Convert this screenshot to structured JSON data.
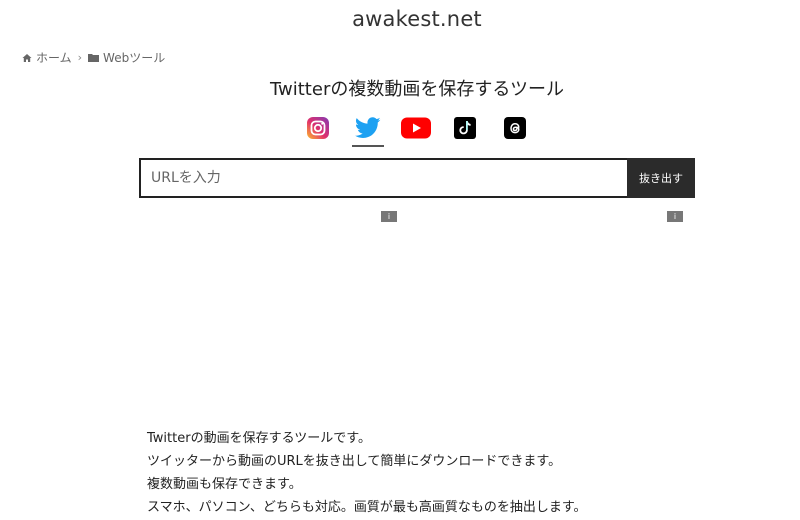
{
  "site": {
    "title": "awakest.net"
  },
  "breadcrumb": [
    {
      "label": "ホーム",
      "icon": "home-icon"
    },
    {
      "label": "Webツール",
      "icon": "folder-icon"
    }
  ],
  "page": {
    "title": "Twitterの複数動画を保存するツール"
  },
  "services": [
    {
      "name": "Instagram",
      "icon": "instagram-icon",
      "color": "#d6249f"
    },
    {
      "name": "Twitter",
      "icon": "twitter-icon",
      "color": "#1da1f2",
      "active": true
    },
    {
      "name": "YouTube",
      "icon": "youtube-icon",
      "color": "#ff0000"
    },
    {
      "name": "TikTok",
      "icon": "tiktok-icon",
      "color": "#000000"
    },
    {
      "name": "Threads",
      "icon": "threads-icon",
      "color": "#000000"
    }
  ],
  "form": {
    "placeholder": "URLを入力",
    "value": "",
    "submit_label": "抜き出す"
  },
  "ads": [
    {
      "badge": "i"
    },
    {
      "badge": "i"
    }
  ],
  "description": {
    "lines": [
      "Twitterの動画を保存するツールです。",
      "ツイッターから動画のURLを抜き出して簡単にダウンロードできます。",
      "複数動画も保存できます。",
      "スマホ、パソコン、どちらも対応。画質が最も高画質なものを抽出します。"
    ]
  }
}
